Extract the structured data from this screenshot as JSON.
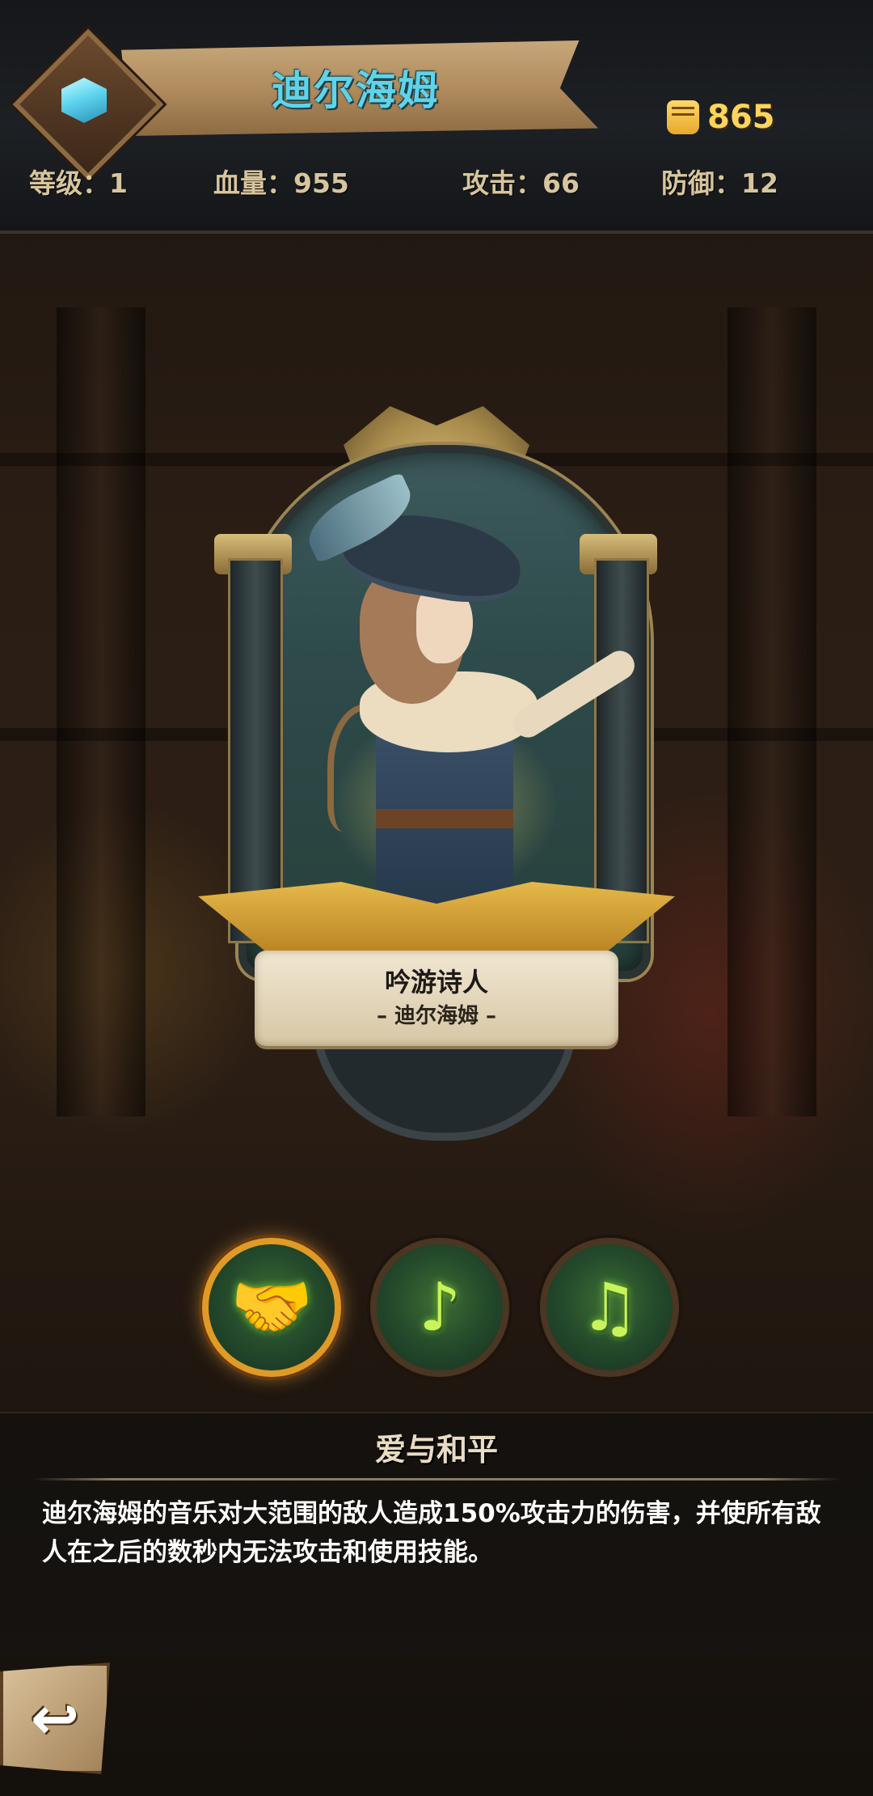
{
  "hero": {
    "name": "迪尔海姆",
    "power": "865",
    "class_title": "吟游诗人",
    "class_subtitle": "– 迪尔海姆 –"
  },
  "stats": {
    "level": "等级：1",
    "hp": "血量：955",
    "attack": "攻击：66",
    "defense": "防御：12"
  },
  "skills": [
    {
      "icon": "handshake-icon",
      "glyph": "🤝",
      "selected": true
    },
    {
      "icon": "music-note-icon",
      "glyph": "♪",
      "selected": false
    },
    {
      "icon": "double-music-note-icon",
      "glyph": "♫",
      "selected": false
    }
  ],
  "skill_detail": {
    "name": "爱与和平",
    "description": "迪尔海姆的音乐对大范围的敌人造成150%攻击力的伤害，并使所有敌人在之后的数秒内无法攻击和使用技能。"
  },
  "colors": {
    "accent_cyan": "#5fd4e8",
    "power_gold": "#ffd45a",
    "skill_green": "#c9f35a",
    "selected_ring": "#e09a26"
  }
}
